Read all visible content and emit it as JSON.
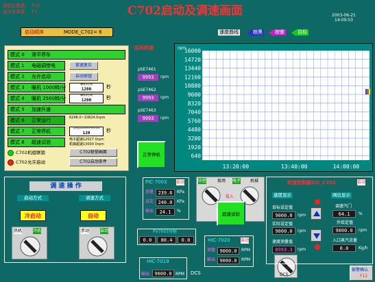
{
  "header": {
    "nav_main": "返回主画面",
    "nav_main_key": "F10",
    "nav_menu": "显示主菜单",
    "nav_menu_key": "F1",
    "title": "C702启动及调速画面",
    "date": "2003-06-21",
    "time": "14:09:53"
  },
  "start_seq": {
    "label": "启动顺序",
    "value": "MODE_C702= 6"
  },
  "curve_legend": {
    "title": "速度曲线",
    "items": [
      {
        "label": "棕黑",
        "color": "#3030c8"
      },
      {
        "label": "棕紫",
        "color": "#c81ec8"
      },
      {
        "label": "目标",
        "color": "#19c819"
      }
    ]
  },
  "modes": [
    {
      "num": "模式 0",
      "name": "滑平停车"
    },
    {
      "num": "模式 1",
      "name": "电磁调带电",
      "btn": "紧速复位"
    },
    {
      "num": "模式 2",
      "name": "允许启动",
      "btn": "启动按钮"
    },
    {
      "num": "模式 3",
      "name": "暖机 1000转/分",
      "box_top": "暖机时间",
      "box_val": "1200",
      "unit": "秒"
    },
    {
      "num": "模式 4",
      "name": "暖机 2500转/分",
      "box_top": "暖机时间",
      "box_val": "1200",
      "unit": "秒"
    },
    {
      "num": "模式 5",
      "name": "加速升速"
    },
    {
      "num": "模式 6",
      "name": "正常运行",
      "extra": "6248.0~10824.0rpm"
    },
    {
      "num": "模式 7",
      "name": "正常停机",
      "box_top": "停机1000RPM时间",
      "box_val": "120",
      "unit": "秒"
    },
    {
      "num": "模式 8",
      "name": "超速试验",
      "extra": "电子超速12027 0rpm\n机械超速13000 0rpm"
    }
  ],
  "status": {
    "ready": "C702机组联锁",
    "permit": "C702允许启动",
    "btn_interlock": "C702联锁画面",
    "btn_conditions": "C702启动条件"
  },
  "speed_readouts": {
    "title": "实际转速",
    "items": [
      {
        "tag": "pSE7461",
        "value": "9993",
        "unit": "rpm"
      },
      {
        "tag": "pSE7462",
        "value": "9993",
        "unit": "rpm"
      },
      {
        "tag": "pSE7463",
        "value": "9993",
        "unit": "rpm"
      }
    ]
  },
  "normal_stop": "正常停机",
  "chart_data": {
    "type": "line",
    "ylabel": "rpm",
    "ylim": [
      0,
      16000
    ],
    "y_ticks": [
      16000,
      14720,
      13440,
      12160,
      10880,
      9600,
      8320,
      7040,
      5760,
      4480,
      3200,
      1920,
      640
    ],
    "x_ticks": [
      "13:20:00",
      "13:40:00",
      "14:00:00"
    ],
    "series": [
      {
        "values": [
          9993,
          9993,
          9993,
          9993,
          9993,
          9993,
          9993
        ],
        "color": "#ffffff"
      }
    ],
    "grid": true
  },
  "regulation": {
    "title": "调 速 操 作",
    "start_mode_label": "启动方式",
    "regulation_mode_label": "调速方式",
    "start_value": "冷启动",
    "regulation_value": "自动",
    "sw1_left": "热机",
    "sw1_right": "冷机",
    "sw2_left": "手动",
    "sw2_right": "自动"
  },
  "pic7003": {
    "tag": "PIC-7003",
    "mode": "自动",
    "rows": [
      {
        "label": "测量",
        "value": "239.6",
        "unit": "KPa"
      },
      {
        "label": "设定",
        "value": "240.0",
        "unit": "KPa"
      },
      {
        "label": "输出",
        "value": "24.1",
        "unit": "%"
      }
    ]
  },
  "pv7003": {
    "title": "PV7003分程",
    "vals": [
      "0.0",
      "80.4",
      "0.0"
    ]
  },
  "hic7019": {
    "tag": "HIC-7019",
    "row_label": "输出",
    "value": "9000.0",
    "unit": "RPM"
  },
  "hic7020": {
    "tag": "HIC-7020",
    "mode": "自动",
    "rows": [
      {
        "label": "测量",
        "value": "9000.0",
        "unit": "RPM"
      },
      {
        "label": "输出",
        "value": "9000.0",
        "unit": "RPM"
      }
    ]
  },
  "dcs_label": "DCS",
  "switch_center": {
    "labels": [
      "中控",
      "现场",
      "电子",
      "机械"
    ],
    "overspeed": "超速试验",
    "alarm": "投入"
  },
  "sic": {
    "title": "转速控制器SIC_C702",
    "mode": "自动",
    "speed_display": "速度显示",
    "valve_display": "阀位显示",
    "target_label": "目标设定值",
    "target_value": "9000.0",
    "actual_label": "实际设定值",
    "actual_value": "9000.0",
    "measure_label": "速度测量值",
    "measure_value": "8993.3",
    "rpm": "rpm",
    "valve_label": "调速汽门",
    "valve_value": "64.1",
    "valve_unit": "%",
    "ext_label": "外给定值",
    "ext_value": "9000.0",
    "ext_unit": "rpm",
    "flow_label": "入口蒸汽流量",
    "flow_value": "0.0",
    "flow_unit": "Kg/h",
    "dcs": "DCS"
  },
  "alarm_btn": {
    "label": "报警确认",
    "key": "F12"
  }
}
